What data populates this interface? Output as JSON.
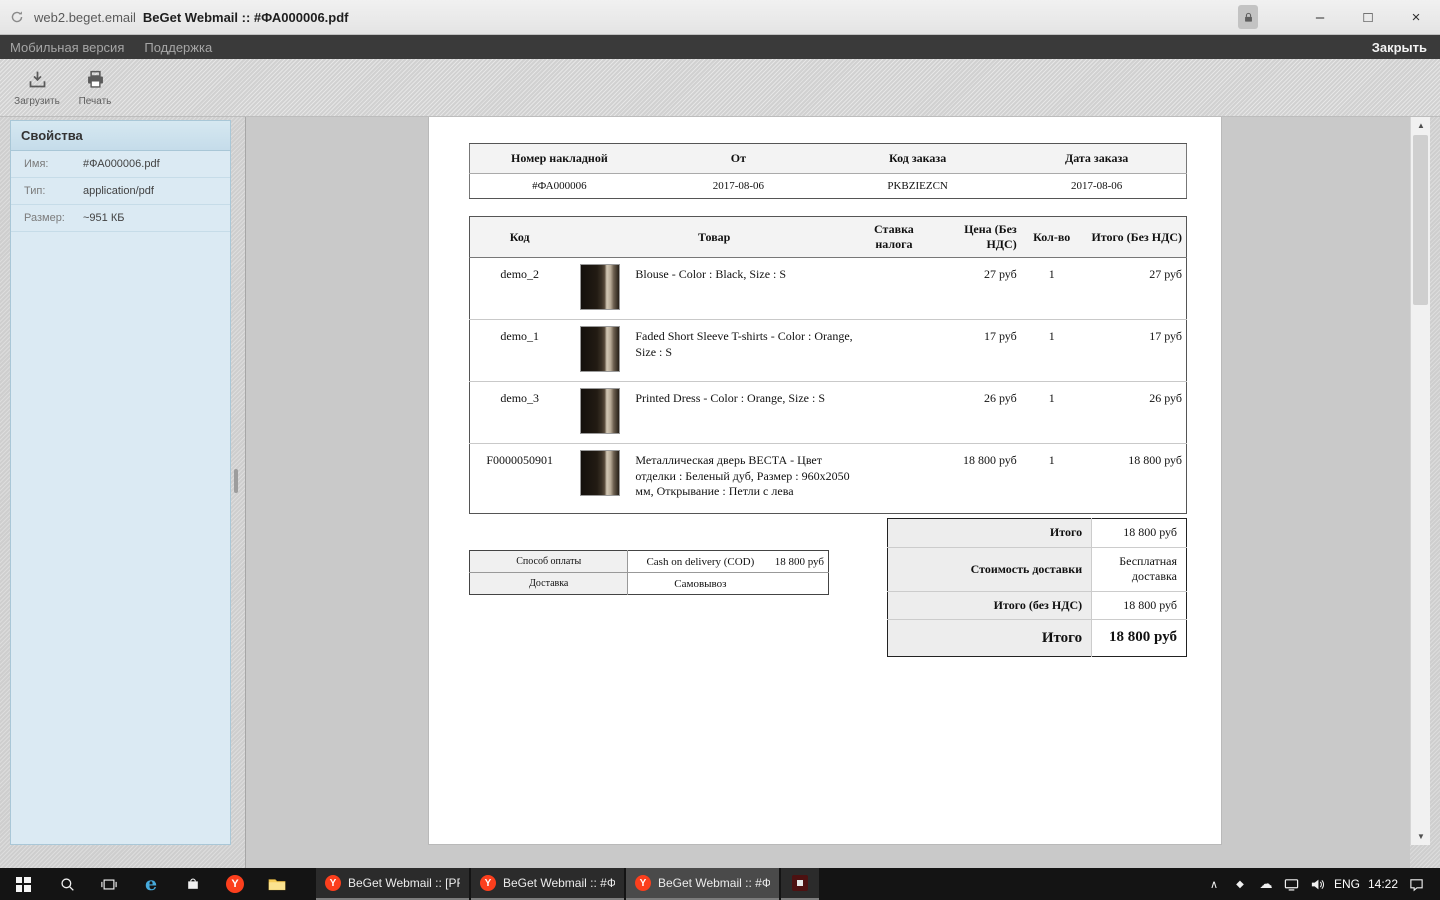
{
  "titlebar": {
    "site": "web2.beget.email",
    "title": "BeGet Webmail :: #ФА000006.pdf"
  },
  "menubar": {
    "mobile_version": "Мобильная версия",
    "support": "Поддержка",
    "close": "Закрыть"
  },
  "toolbar": {
    "download": "Загрузить",
    "print": "Печать"
  },
  "properties": {
    "title": "Свойства",
    "rows": [
      {
        "label": "Имя:",
        "value": "#ФА000006.pdf"
      },
      {
        "label": "Тип:",
        "value": "application/pdf"
      },
      {
        "label": "Размер:",
        "value": "~951 КБ"
      }
    ]
  },
  "invoice": {
    "meta": {
      "columns": [
        "Номер накладной",
        "От",
        "Код заказа",
        "Дата заказа"
      ],
      "values": [
        "#ФА000006",
        "2017-08-06",
        "PKBZIEZCN",
        "2017-08-06"
      ]
    },
    "items": {
      "col_code": "Код",
      "col_product": "Товар",
      "col_tax": "Ставка налога",
      "col_price": "Цена (Без НДС)",
      "col_qty": "Кол-во",
      "col_total": "Итого (Без НДС)",
      "rows": [
        {
          "code": "demo_2",
          "product": "Blouse - Color : Black, Size : S",
          "tax": "",
          "price": "27 руб",
          "qty": "1",
          "total": "27 руб"
        },
        {
          "code": "demo_1",
          "product": "Faded Short Sleeve T-shirts - Color : Orange, Size : S",
          "tax": "",
          "price": "17 руб",
          "qty": "1",
          "total": "17 руб"
        },
        {
          "code": "demo_3",
          "product": "Printed Dress - Color : Orange, Size : S",
          "tax": "",
          "price": "26 руб",
          "qty": "1",
          "total": "26 руб"
        },
        {
          "code": "F0000050901",
          "product": "Металлическая дверь ВЕСТА - Цвет отделки : Беленый дуб, Размер : 960x2050 мм, Открывание : Петли с лева",
          "tax": "",
          "price": "18 800 руб",
          "qty": "1",
          "total": "18 800 руб"
        }
      ]
    },
    "payment": {
      "method_label": "Способ оплаты",
      "method_value": "Cash on delivery (COD)",
      "method_amount": "18 800 руб",
      "delivery_label": "Доставка",
      "delivery_value": "Самовывоз"
    },
    "totals": {
      "rows": [
        {
          "label": "Итого",
          "value": "18 800 руб"
        },
        {
          "label": "Стоимость доставки",
          "value": "Бесплатная доставка"
        },
        {
          "label": "Итого (без НДС)",
          "value": "18 800 руб"
        },
        {
          "label": "Итого",
          "value": "18 800 руб"
        }
      ]
    }
  },
  "taskbar": {
    "apps": [
      {
        "label": "BeGet Webmail :: [PR..."
      },
      {
        "label": "BeGet Webmail :: #Ф..."
      },
      {
        "label": "BeGet Webmail :: #Ф..."
      }
    ],
    "tray": {
      "language": "ENG",
      "time": "14:22"
    }
  },
  "icons": {
    "minimize": "–",
    "maximize": "□",
    "close": "×",
    "scroll_up": "▲",
    "scroll_down": "▼",
    "chevron_up": "∧",
    "diamond": "◆",
    "cloud": "☁",
    "edge": "e",
    "yandex": "Y"
  }
}
